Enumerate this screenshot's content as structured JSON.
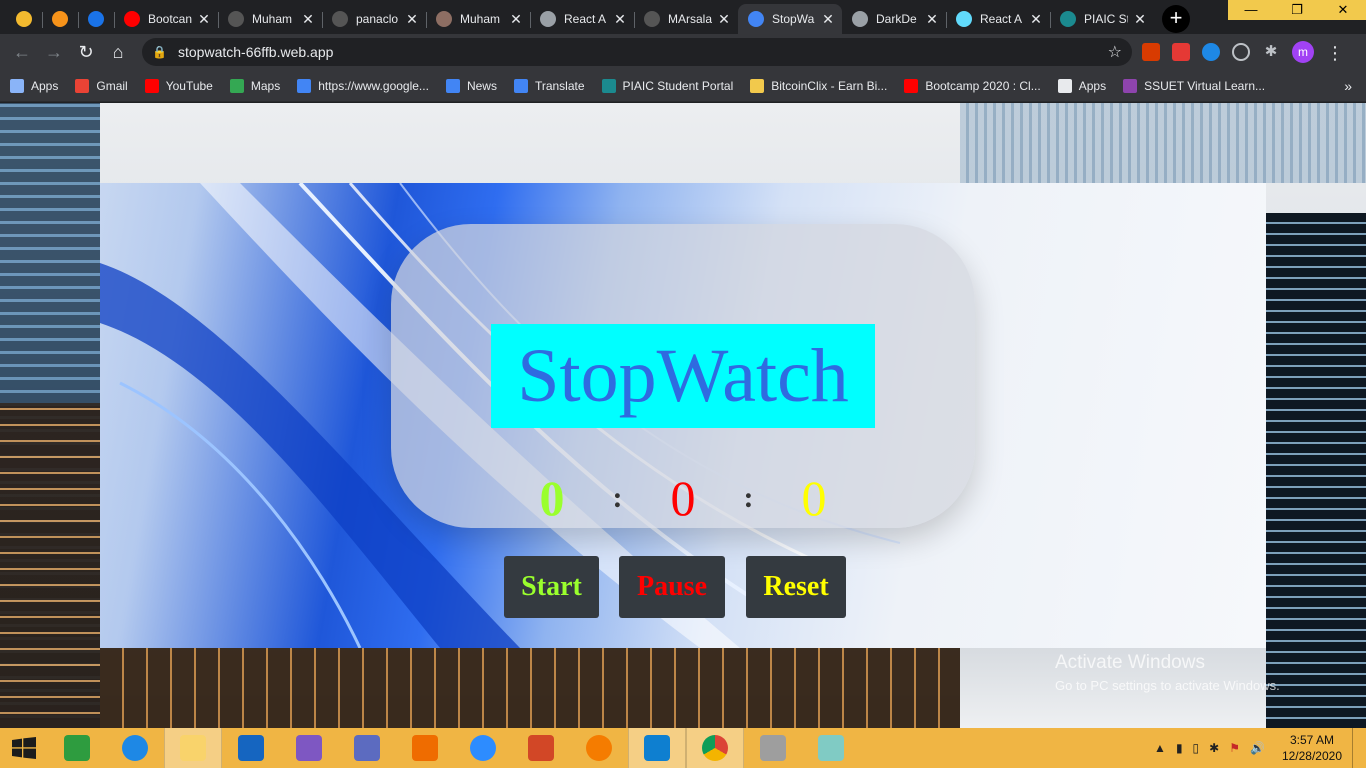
{
  "browser": {
    "tabs": [
      {
        "label": "",
        "icon": "binance-icon",
        "color": "#f3ba2f",
        "small": true
      },
      {
        "label": "",
        "icon": "coin-icon",
        "color": "#f7931a",
        "small": true
      },
      {
        "label": "",
        "icon": "chart-icon",
        "color": "#1a73e8",
        "small": true
      },
      {
        "label": "Bootcan",
        "icon": "youtube-icon",
        "color": "#ff0000"
      },
      {
        "label": "Muham",
        "icon": "github-icon",
        "color": "#555555"
      },
      {
        "label": "panaclo",
        "icon": "github-icon",
        "color": "#555555"
      },
      {
        "label": "Muham",
        "icon": "profile-icon",
        "color": "#8d6e63"
      },
      {
        "label": "React A",
        "icon": "globe-icon",
        "color": "#9aa0a6"
      },
      {
        "label": "MArsala",
        "icon": "github-icon",
        "color": "#555555"
      },
      {
        "label": "StopWa",
        "icon": "stopwatch-icon",
        "color": "#4285f4",
        "active": true
      },
      {
        "label": "DarkDe",
        "icon": "globe-icon",
        "color": "#9aa0a6"
      },
      {
        "label": "React A",
        "icon": "react-icon",
        "color": "#61dafb"
      },
      {
        "label": "PIAIC St",
        "icon": "piaic-icon",
        "color": "#1b8a8f"
      }
    ],
    "new_tab_label": "+",
    "address": {
      "url": "stopwatch-66ffb.web.app"
    },
    "profile_initial": "m",
    "bookmarks": [
      {
        "label": "Apps",
        "icon": "apps-grid-icon",
        "color": "#8ab4f8"
      },
      {
        "label": "Gmail",
        "icon": "gmail-icon",
        "color": "#ea4335"
      },
      {
        "label": "YouTube",
        "icon": "youtube-icon",
        "color": "#ff0000"
      },
      {
        "label": "Maps",
        "icon": "maps-icon",
        "color": "#34a853"
      },
      {
        "label": "https://www.google...",
        "icon": "google-icon",
        "color": "#4285f4"
      },
      {
        "label": "News",
        "icon": "news-icon",
        "color": "#4285f4"
      },
      {
        "label": "Translate",
        "icon": "translate-icon",
        "color": "#4285f4"
      },
      {
        "label": "PIAIC Student Portal",
        "icon": "piaic-icon",
        "color": "#1b8a8f"
      },
      {
        "label": "BitcoinClix - Earn Bi...",
        "icon": "bitcoin-icon",
        "color": "#f2c94c"
      },
      {
        "label": "Bootcamp 2020 : Cl...",
        "icon": "youtube-icon",
        "color": "#ff0000"
      },
      {
        "label": "Apps",
        "icon": "apps-grid-icon",
        "color": "#e8eaed"
      },
      {
        "label": "SSUET Virtual Learn...",
        "icon": "ssuet-icon",
        "color": "#8e44ad"
      }
    ],
    "bookmarks_more": "»"
  },
  "app": {
    "title": "StopWatch",
    "timer": {
      "hours": "0",
      "separator": ":",
      "minutes": "0",
      "seconds": "0"
    },
    "buttons": {
      "start": "Start",
      "pause": "Pause",
      "reset": "Reset"
    }
  },
  "watermark": {
    "line1": "Activate Windows",
    "line2": "Go to PC settings to activate Windows."
  },
  "taskbar": {
    "apps": [
      {
        "icon": "store-icon",
        "color": "#2e9c3f"
      },
      {
        "icon": "internet-explorer-icon",
        "color": "#1e88e5"
      },
      {
        "icon": "file-explorer-icon",
        "color": "#f9d36b",
        "active": true
      },
      {
        "icon": "mail-icon",
        "color": "#1565c0"
      },
      {
        "icon": "visual-studio-icon",
        "color": "#7e57c2"
      },
      {
        "icon": "infinity-icon",
        "color": "#5c6bc0"
      },
      {
        "icon": "video-player-icon",
        "color": "#ef6c00"
      },
      {
        "icon": "zoom-icon",
        "color": "#2d8cff"
      },
      {
        "icon": "powerpoint-icon",
        "color": "#d24726"
      },
      {
        "icon": "c-app-icon",
        "color": "#f57c00"
      },
      {
        "icon": "vscode-icon",
        "color": "#0e7fd0",
        "active": true
      },
      {
        "icon": "chrome-icon",
        "color": "#4caf50",
        "active": true
      },
      {
        "icon": "monitor-app-icon",
        "color": "#9e9e9e"
      },
      {
        "icon": "notepad-icon",
        "color": "#80cbc4"
      }
    ],
    "clock": {
      "time": "3:57 AM",
      "date": "12/28/2020"
    }
  }
}
